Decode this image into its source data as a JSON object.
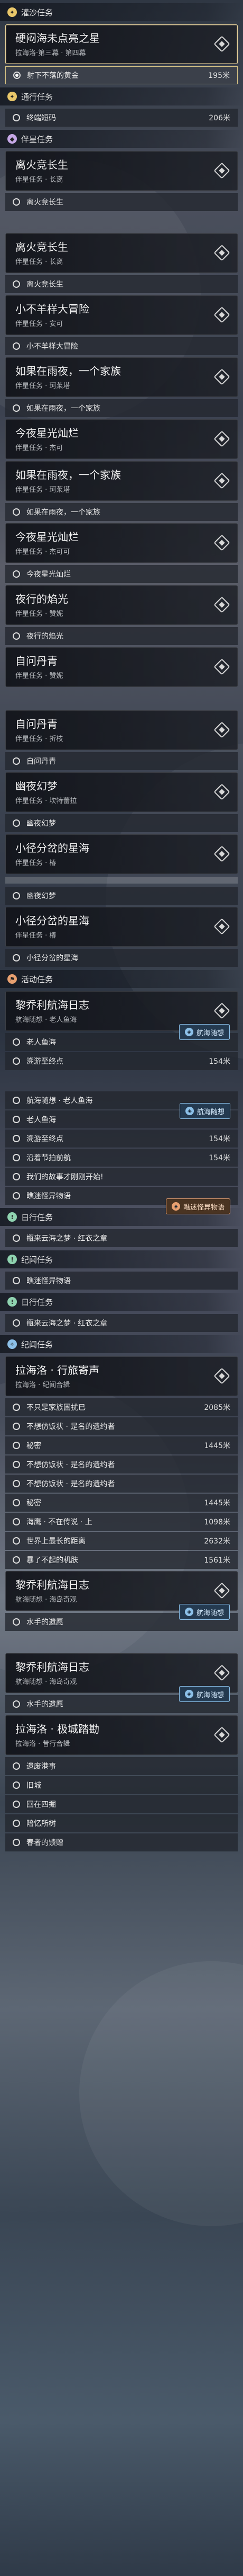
{
  "sections": [
    {
      "type": "sec",
      "tone": "gold",
      "icon": "star",
      "label": "灌沙任务"
    },
    {
      "type": "card",
      "title": "硬闷海未点亮之星",
      "sub": "拉海洛·第三幕 · 第四幕",
      "active": true
    },
    {
      "type": "obj",
      "text": "射下不落的黄金",
      "dist": "195米",
      "on": true,
      "hl": true
    },
    {
      "type": "sec",
      "tone": "gold",
      "icon": "star",
      "label": "通行任务"
    },
    {
      "type": "obj",
      "text": "终端短码",
      "dist": "206米"
    },
    {
      "type": "sec",
      "tone": "purple",
      "icon": "book",
      "label": "伴星任务"
    },
    {
      "type": "card",
      "title": "离火竞长生",
      "sub": "伴星任务 · 长离"
    },
    {
      "type": "obj",
      "text": "离火竞长生"
    },
    {
      "type": "gap"
    },
    {
      "type": "card",
      "title": "离火竞长生",
      "sub": "伴星任务 · 长离"
    },
    {
      "type": "obj",
      "text": "离火竞长生"
    },
    {
      "type": "card",
      "title": "小不羊样大冒险",
      "sub": "伴星任务 · 安可"
    },
    {
      "type": "obj",
      "text": "小不羊样大冒险"
    },
    {
      "type": "card",
      "title": "如果在雨夜，一个家族",
      "sub": "伴星任务 · 珂莱塔"
    },
    {
      "type": "obj",
      "text": "如果在雨夜，一个家族"
    },
    {
      "type": "card",
      "title": "今夜星光灿烂",
      "sub": "伴星任务 · 杰可"
    },
    {
      "type": "card",
      "title": "如果在雨夜，一个家族",
      "sub": "伴星任务 · 珂莱塔"
    },
    {
      "type": "obj",
      "text": "如果在雨夜，一个家族"
    },
    {
      "type": "card",
      "title": "今夜星光灿烂",
      "sub": "伴星任务 · 杰可可"
    },
    {
      "type": "obj",
      "text": "今夜星光灿烂"
    },
    {
      "type": "card",
      "title": "夜行的焰光",
      "sub": "伴星任务 · 赞妮"
    },
    {
      "type": "obj",
      "text": "夜行的焰光"
    },
    {
      "type": "card",
      "title": "自问丹青",
      "sub": "伴星任务 · 赞妮"
    },
    {
      "type": "gap"
    },
    {
      "type": "card",
      "title": "自问丹青",
      "sub": "伴星任务 · 折枝"
    },
    {
      "type": "obj",
      "text": "自问丹青"
    },
    {
      "type": "card",
      "title": "幽夜幻梦",
      "sub": "伴星任务 · 坎特蕾拉"
    },
    {
      "type": "obj",
      "text": "幽夜幻梦"
    },
    {
      "type": "card",
      "title": "小径分岔的星海",
      "sub": "伴星任务 · 椿"
    },
    {
      "type": "bar"
    },
    {
      "type": "obj",
      "text": "幽夜幻梦"
    },
    {
      "type": "card",
      "title": "小径分岔的星海",
      "sub": "伴星任务 · 椿"
    },
    {
      "type": "obj",
      "text": "小径分岔的星海"
    },
    {
      "type": "sec",
      "tone": "orange",
      "icon": "flag",
      "label": "活动任务"
    },
    {
      "type": "card",
      "title": "黎乔利航海日志",
      "sub": "航海随想 · 老人鱼海",
      "badge": "航海随想",
      "badgeTone": "blue"
    },
    {
      "type": "obj",
      "text": "老人鱼海"
    },
    {
      "type": "obj",
      "text": "溯游至终点",
      "dist": "154米"
    },
    {
      "type": "gap"
    },
    {
      "type": "obj",
      "text": "航海随想 · 老人鱼海",
      "badge": "航海随想",
      "badgeTone": "blue"
    },
    {
      "type": "obj",
      "text": "老人鱼海"
    },
    {
      "type": "obj",
      "text": "溯游至终点",
      "dist": "154米"
    },
    {
      "type": "obj",
      "text": "沿着节拍前航",
      "dist": "154米"
    },
    {
      "type": "obj",
      "text": "我们的故事才刚刚开始!"
    },
    {
      "type": "obj",
      "text": "瞧迷怪异物语",
      "badge": "瞧迷怪异物语",
      "badgeTone": "orange"
    },
    {
      "type": "sec",
      "tone": "green",
      "icon": "quest",
      "label": "日行任务"
    },
    {
      "type": "obj",
      "text": "瓶来云海之梦 · 红衣之章"
    },
    {
      "type": "sec",
      "tone": "green",
      "icon": "quest",
      "label": "纪闻任务"
    },
    {
      "type": "obj",
      "text": "瞧迷怪异物语"
    },
    {
      "type": "sec",
      "tone": "green",
      "icon": "quest",
      "label": "日行任务"
    },
    {
      "type": "obj",
      "text": "瓶来云海之梦 · 红衣之章"
    },
    {
      "type": "sec",
      "tone": "blue",
      "icon": "compass",
      "label": "纪闻任务"
    },
    {
      "type": "card",
      "title": "拉海洛 · 行旅寄声",
      "sub": "拉海洛 · 纪闻合辑"
    },
    {
      "type": "obj",
      "text": "不只是家族困扰已",
      "dist": "2085米"
    },
    {
      "type": "obj",
      "text": "不想仿饭状 · 是名的遗约者"
    },
    {
      "type": "obj",
      "text": "秘密",
      "dist": "1445米"
    },
    {
      "type": "obj",
      "text": "不想仿饭状 · 是名的遗约者"
    },
    {
      "type": "obj",
      "text": "不想仿饭状 · 是名的遗约者"
    },
    {
      "type": "obj",
      "text": "秘密",
      "dist": "1445米"
    },
    {
      "type": "obj",
      "text": "海鹰 · 不在传说 · 上",
      "dist": "1098米"
    },
    {
      "type": "obj",
      "text": "世界上最长的距离",
      "dist": "2632米"
    },
    {
      "type": "obj",
      "text": "暴了不起的机肤",
      "dist": "1561米"
    },
    {
      "type": "card",
      "title": "黎乔利航海日志",
      "sub": "航海随想 · 海岛奇观",
      "badge": "航海随想",
      "badgeTone": "blue"
    },
    {
      "type": "obj",
      "text": "水手的遗愿"
    },
    {
      "type": "gap"
    },
    {
      "type": "card",
      "title": "黎乔利航海日志",
      "sub": "航海随想 · 海岛奇观",
      "badge": "航海随想",
      "badgeTone": "blue"
    },
    {
      "type": "obj",
      "text": "水手的遗愿"
    },
    {
      "type": "card",
      "title": "拉海洛 · 极城踏勘",
      "sub": "拉海洛 · 昔行合辑"
    },
    {
      "type": "obj",
      "text": "遗废港事"
    },
    {
      "type": "obj",
      "text": "旧城"
    },
    {
      "type": "obj",
      "text": "回在四掘"
    },
    {
      "type": "obj",
      "text": "陪忆所树"
    },
    {
      "type": "obj",
      "text": "春者的馈赠"
    }
  ],
  "colors": {
    "gold": "#e9c76a",
    "purple": "#c6a8e6",
    "orange": "#e8a070",
    "green": "#8fd3b0",
    "blue": "#8cc0e8",
    "highlight": "#d6c284"
  }
}
